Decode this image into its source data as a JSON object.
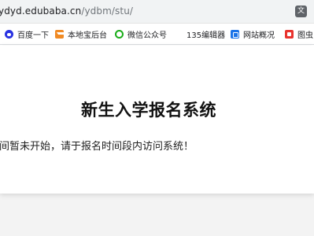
{
  "address_bar": {
    "url_host": "ydyd.edubaba.cn",
    "url_path": "/ydbm/stu/",
    "translate_icon": "translate-icon"
  },
  "bookmarks": [
    {
      "label": "百度一下",
      "icon": "baidu-icon"
    },
    {
      "label": "本地宝后台",
      "icon": "house-icon"
    },
    {
      "label": "微信公众号",
      "icon": "wechat-icon"
    },
    {
      "label": "135编辑器",
      "icon": "editor-135-icon",
      "icon_text": "135"
    },
    {
      "label": "网站概况",
      "icon": "stats-icon"
    },
    {
      "label": "图虫",
      "icon": "image-icon"
    }
  ],
  "page": {
    "title": "新生入学报名系统",
    "notice": "间暂未开始，请于报名时间段内访问系统！"
  }
}
